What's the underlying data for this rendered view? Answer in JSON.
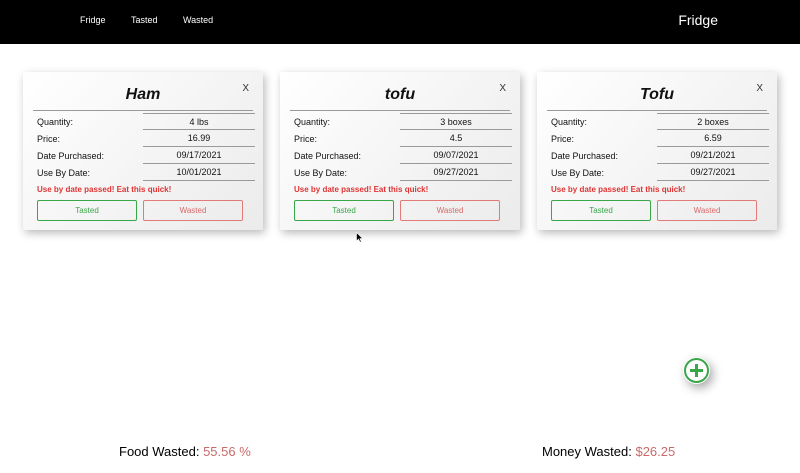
{
  "navbar": {
    "links": [
      "Fridge",
      "Tasted",
      "Wasted"
    ],
    "brand": "Fridge"
  },
  "labels": {
    "quantity": "Quantity:",
    "price": "Price:",
    "date_purchased": "Date Purchased:",
    "use_by": "Use By Date:",
    "warning": "Use by date passed! Eat this quick!",
    "close": "X",
    "tasted_button": "Tasted",
    "wasted_button": "Wasted"
  },
  "cards": [
    {
      "name": "Ham",
      "quantity": "4 lbs",
      "price": "16.99",
      "date_purchased": "09/17/2021",
      "use_by": "10/01/2021"
    },
    {
      "name": "tofu",
      "quantity": "3 boxes",
      "price": "4.5",
      "date_purchased": "09/07/2021",
      "use_by": "09/27/2021"
    },
    {
      "name": "Tofu",
      "quantity": "2 boxes",
      "price": "6.59",
      "date_purchased": "09/21/2021",
      "use_by": "09/27/2021"
    }
  ],
  "footer": {
    "food_wasted_label": "Food Wasted:",
    "food_wasted_value": "55.56 %",
    "money_wasted_label": "Money Wasted:",
    "money_wasted_value": "$26.25"
  },
  "icons": {
    "add": "plus-icon",
    "cursor": "mouse-pointer-icon"
  },
  "colors": {
    "tasted": "#3aa64a",
    "wasted": "#e27a7a",
    "warning": "#e03333",
    "add": "#3aa64a"
  }
}
